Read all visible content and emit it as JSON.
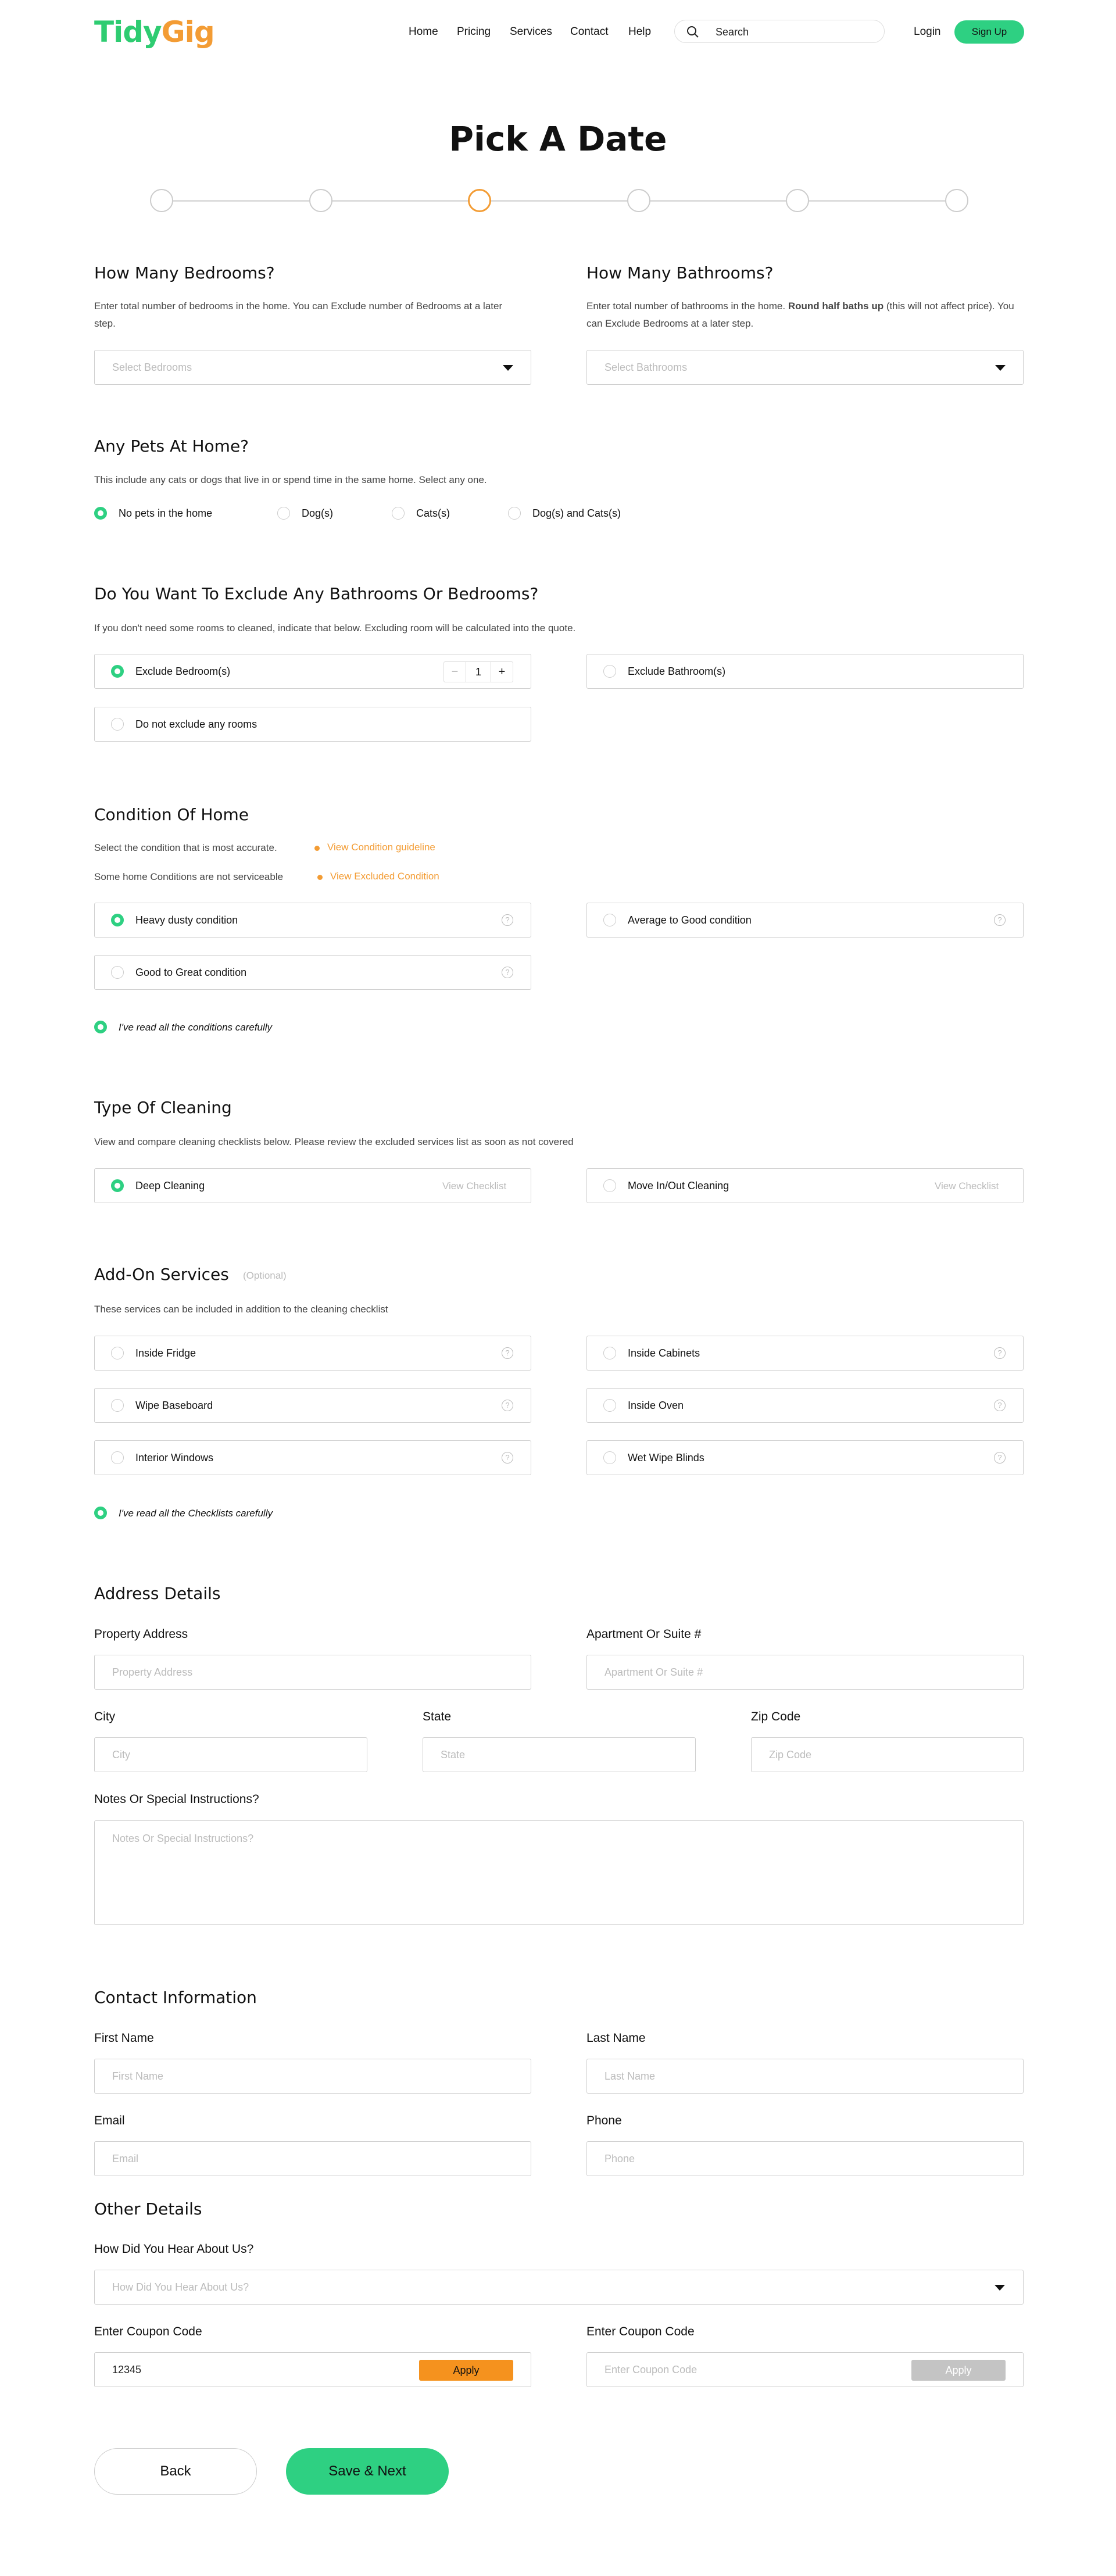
{
  "header": {
    "logo_part1": "Tidy",
    "logo_part2": "Gig",
    "nav": [
      "Home",
      "Pricing",
      "Services",
      "Contact",
      "Help"
    ],
    "search_placeholder": "Search",
    "login": "Login",
    "signup": "Sign Up"
  },
  "page_title": "Pick A Date",
  "progress": {
    "total_steps": 6,
    "current_step": 3
  },
  "bedrooms": {
    "title": "How Many Bedrooms?",
    "desc": "Enter total number of bedrooms in the home. You can Exclude number of Bedrooms at a later step.",
    "placeholder": "Select Bedrooms"
  },
  "bathrooms": {
    "title": "How Many Bathrooms?",
    "desc_pre": "Enter total number of bathrooms in the home. ",
    "desc_bold": "Round half baths up",
    "desc_post": " (this will not affect price). You can Exclude Bedrooms at a later step.",
    "placeholder": "Select Bathrooms"
  },
  "pets": {
    "title": "Any Pets At Home?",
    "desc": "This include any cats or dogs that live in or spend time in the same home. Select any one.",
    "options": [
      "No pets in the home",
      "Dog(s)",
      "Cats(s)",
      "Dog(s) and Cats(s)"
    ],
    "selected": "No pets in the home"
  },
  "exclude": {
    "title": "Do You Want To Exclude Any Bathrooms Or Bedrooms?",
    "desc": "If you don't need some rooms to cleaned, indicate that below. Excluding room will be calculated into the quote.",
    "opt_bed": "Exclude Bedroom(s)",
    "opt_bath": "Exclude Bathroom(s)",
    "opt_none": "Do not exclude any rooms",
    "minus": "−",
    "plus": "+",
    "count": "1"
  },
  "condition": {
    "title": "Condition Of Home",
    "desc1": "Select the condition that is most accurate.",
    "link1": "View Condition guideline",
    "desc2": "Some home Conditions are not serviceable",
    "link2": "View Excluded Condition",
    "opt1": "Heavy dusty condition",
    "opt2": "Average to Good condition",
    "opt3": "Good to Great condition",
    "confirm": "I've read all the conditions carefully"
  },
  "cleaning": {
    "title": "Type Of Cleaning",
    "desc": "View and compare cleaning checklists below. Please review the excluded services list as soon as not covered",
    "opt1": "Deep Cleaning",
    "opt2": "Move In/Out Cleaning",
    "checklist": "View Checklist"
  },
  "addons": {
    "title": "Add-On Services",
    "optional": "(Optional)",
    "desc": "These services can be included in addition to the cleaning checklist",
    "items": [
      "Inside Fridge",
      "Inside Cabinets",
      "Wipe Baseboard",
      "Inside Oven",
      "Interior Windows",
      "Wet Wipe Blinds"
    ],
    "confirm": "I've read all the Checklists carefully"
  },
  "address": {
    "title": "Address Details",
    "property_label": "Property Address",
    "property_ph": "Property Address",
    "apt_label": "Apartment Or Suite #",
    "apt_ph": "Apartment Or Suite #",
    "city_label": "City",
    "city_ph": "City",
    "state_label": "State",
    "state_ph": "State",
    "zip_label": "Zip Code",
    "zip_ph": "Zip Code",
    "notes_label": "Notes Or Special Instructions?",
    "notes_ph": "Notes Or Special Instructions?"
  },
  "contact": {
    "title": "Contact Information",
    "first_label": "First Name",
    "first_ph": "First Name",
    "last_label": "Last Name",
    "last_ph": "Last Name",
    "email_label": "Email",
    "email_ph": "Email",
    "phone_label": "Phone",
    "phone_ph": "Phone"
  },
  "other": {
    "title": "Other Details",
    "hear_label": "How Did You Hear About Us?",
    "hear_ph": "How Did You Hear About Us?",
    "coupon_label": "Enter Coupon Code",
    "coupon_value": "12345",
    "coupon_label2": "Enter Coupon Code",
    "coupon_ph": "Enter Coupon Code",
    "apply": "Apply"
  },
  "footer": {
    "back": "Back",
    "save": "Save & Next"
  },
  "colors": {
    "green": "#2ed082",
    "orange": "#f39c34"
  }
}
